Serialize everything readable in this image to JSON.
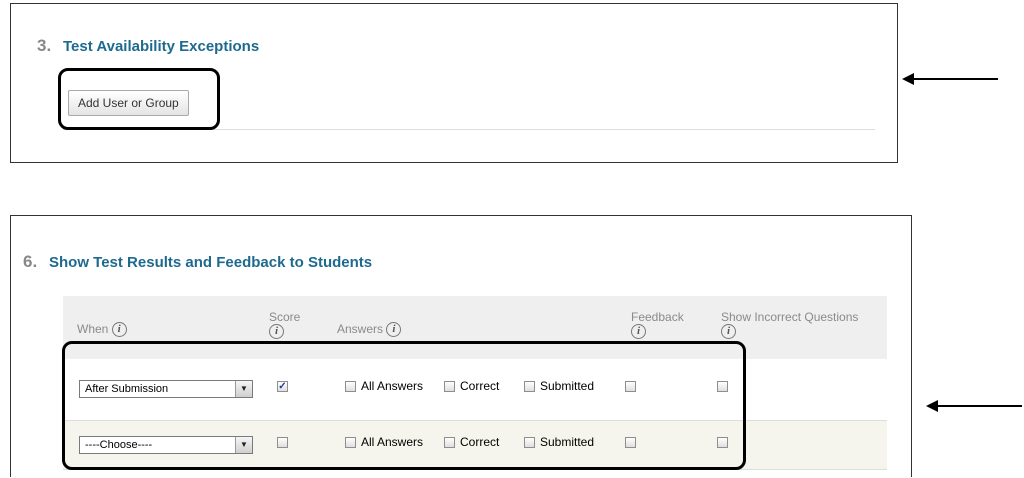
{
  "section3": {
    "number": "3.",
    "title": "Test Availability Exceptions",
    "add_button_label": "Add User or Group"
  },
  "section6": {
    "number": "6.",
    "title": "Show Test Results and Feedback to Students",
    "columns": {
      "when": "When",
      "score": "Score",
      "answers": "Answers",
      "feedback": "Feedback",
      "show_incorrect": "Show Incorrect Questions"
    },
    "info_glyph": "i",
    "rows": [
      {
        "when_value": "After Submission",
        "score_checked": true,
        "all_answers_label": "All Answers",
        "correct_label": "Correct",
        "submitted_label": "Submitted",
        "check_glyph": "✓"
      },
      {
        "when_value": "----Choose----",
        "score_checked": false,
        "all_answers_label": "All Answers",
        "correct_label": "Correct",
        "submitted_label": "Submitted"
      }
    ]
  },
  "dropdown_glyph": "▼",
  "colors": {
    "title_blue": "#1e6a8f",
    "callout": "#000000",
    "alt_row": "#f5f5ed"
  }
}
